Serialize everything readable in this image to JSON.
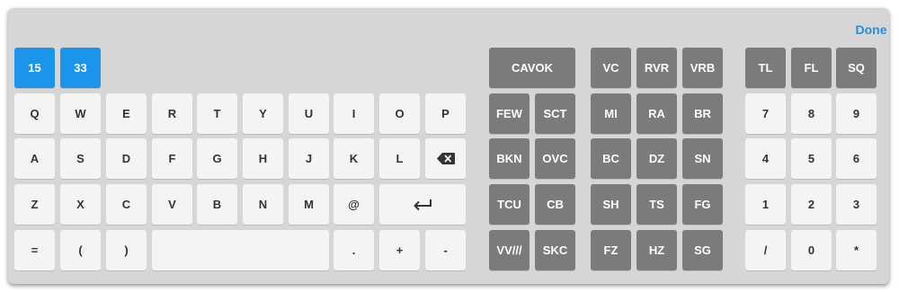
{
  "header": {
    "done_label": "Done"
  },
  "selected": {
    "first": "15",
    "second": "33"
  },
  "alpha_rows": [
    [
      "Q",
      "W",
      "E",
      "R",
      "T",
      "Y",
      "U",
      "I",
      "O",
      "P"
    ],
    [
      "A",
      "S",
      "D",
      "F",
      "G",
      "H",
      "J",
      "K",
      "L"
    ],
    [
      "Z",
      "X",
      "C",
      "V",
      "B",
      "N",
      "M",
      "@"
    ],
    [
      "=",
      "(",
      ")",
      ".",
      "+",
      "-"
    ]
  ],
  "weather": {
    "cavok": "CAVOK",
    "cloud": [
      "FEW",
      "SCT",
      "BKN",
      "OVC",
      "TCU",
      "CB",
      "VV///",
      "SKC"
    ],
    "phenomena": [
      "VC",
      "RVR",
      "VRB",
      "MI",
      "RA",
      "BR",
      "BC",
      "DZ",
      "SN",
      "SH",
      "TS",
      "FG",
      "FZ",
      "HZ",
      "SG"
    ]
  },
  "numpad": {
    "top": [
      "TL",
      "FL",
      "SQ"
    ],
    "digits": [
      "7",
      "8",
      "9",
      "4",
      "5",
      "6",
      "1",
      "2",
      "3",
      "/",
      "0",
      "*"
    ]
  },
  "icons": {
    "backspace": "backspace-icon",
    "enter": "enter-icon"
  },
  "colors": {
    "accent": "#1b95eb",
    "done_text": "#1e8fe0",
    "dark_key": "#7b7b7b",
    "light_key": "#f4f4f4",
    "panel": "#d6d6d6"
  }
}
